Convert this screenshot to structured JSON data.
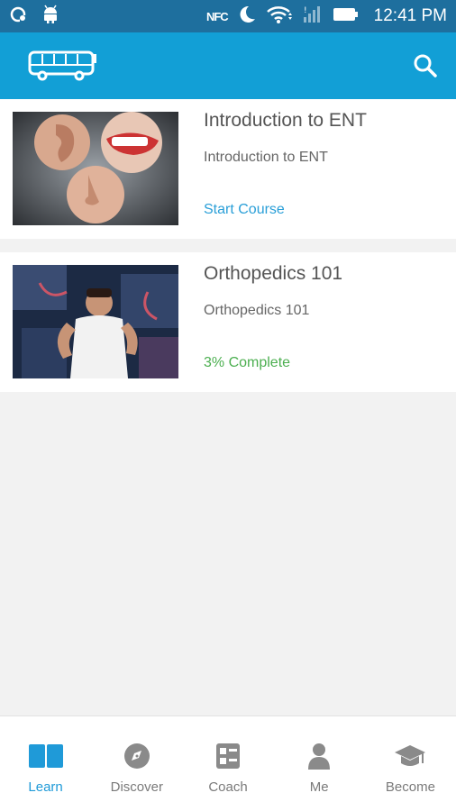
{
  "status_bar": {
    "time": "12:41 PM",
    "nfc": "NFC"
  },
  "courses": [
    {
      "title": "Introduction to ENT",
      "subtitle": "Introduction to ENT",
      "status": "Start Course"
    },
    {
      "title": "Orthopedics 101",
      "subtitle": "Orthopedics 101",
      "status": "3% Complete"
    }
  ],
  "nav": [
    {
      "label": "Learn"
    },
    {
      "label": "Discover"
    },
    {
      "label": "Coach"
    },
    {
      "label": "Me"
    },
    {
      "label": "Become"
    }
  ],
  "colors": {
    "status_bar": "#1e6f9e",
    "app_bar": "#129fd6",
    "start_course": "#2a9fd8",
    "complete": "#4caf50",
    "nav_active": "#1f9ad8",
    "nav_inactive": "#7a7a7a"
  }
}
